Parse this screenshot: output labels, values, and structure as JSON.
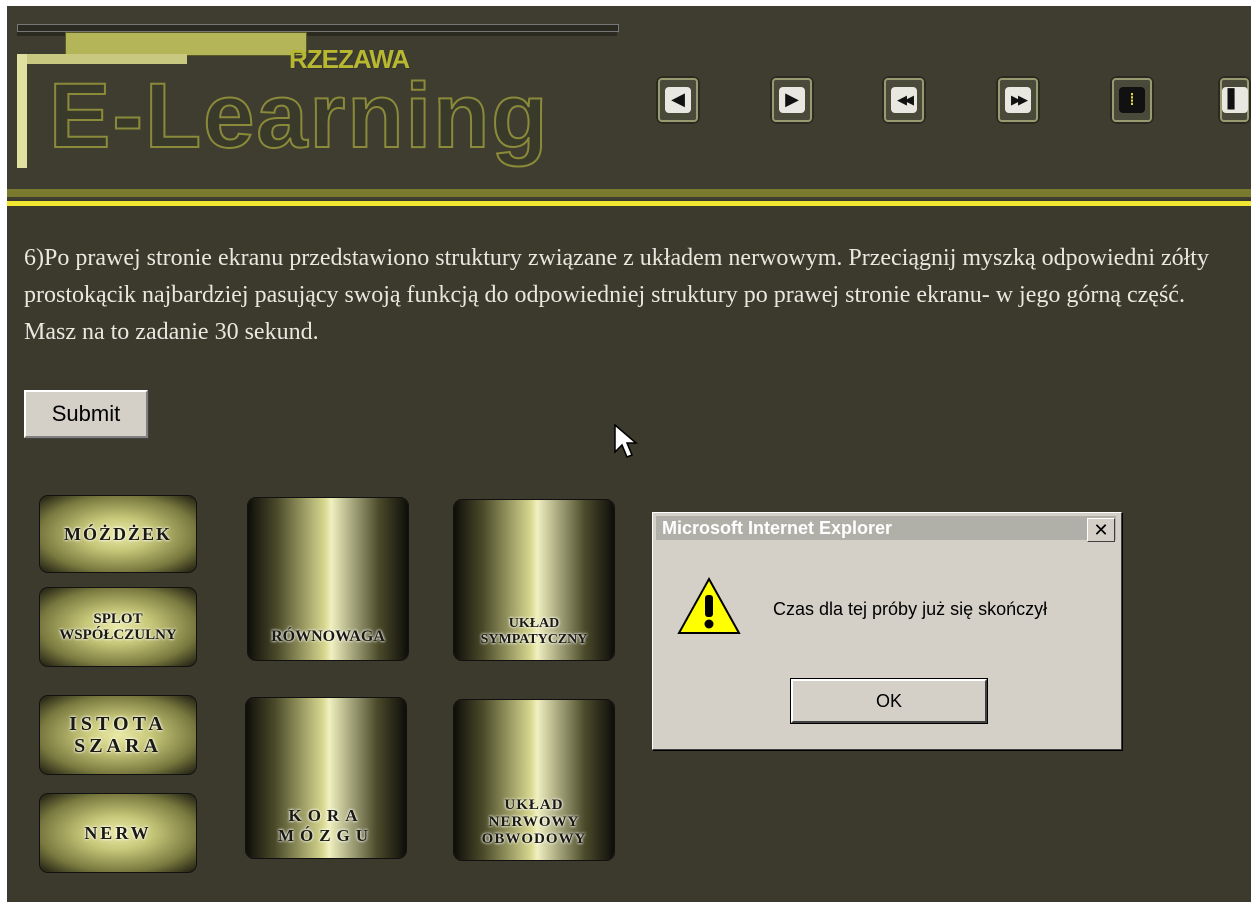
{
  "header": {
    "brand": "RZEZAWA",
    "title": "E-Learning",
    "nav_buttons": [
      {
        "name": "prev-icon",
        "glyph": "◀"
      },
      {
        "name": "next-icon",
        "glyph": "▶"
      },
      {
        "name": "rewind-icon",
        "glyph": "◀◀"
      },
      {
        "name": "fast-forward-icon",
        "glyph": "▶▶"
      },
      {
        "name": "menu-grid-icon",
        "glyph": "⁞"
      },
      {
        "name": "end-icon",
        "glyph": "▌"
      }
    ]
  },
  "question": {
    "text": "6)Po prawej stronie ekranu przedstawiono struktury związane z układem nerwowym. Przeciągnij myszką odpowiedni zółty prostokącik najbardziej pasujący swoją funkcją do odpowiedniej struktury po prawej stronie ekranu- w jego górną część. Masz na to zadanie 30 sekund."
  },
  "submit": {
    "label": "Submit"
  },
  "tiles": {
    "mozdzek": "MÓŻDŻEK",
    "splot": "SPLOT\nWSPÓŁCZULNY",
    "istota": "ISTOTA\nSZARA",
    "nerw": "NERW",
    "rownowaga": "RÓWNOWAGA",
    "kora": "KORA\nMÓZGU",
    "sympatyczny": "UKŁAD\nSYMPATYCZNY",
    "obwodowy": "UKŁAD\nNERWOWY\nOBWODOWY"
  },
  "dialog": {
    "title": "Microsoft Internet Explorer",
    "message": "Czas dla tej próby już się skończył",
    "ok_label": "OK",
    "close_glyph": "✕"
  }
}
